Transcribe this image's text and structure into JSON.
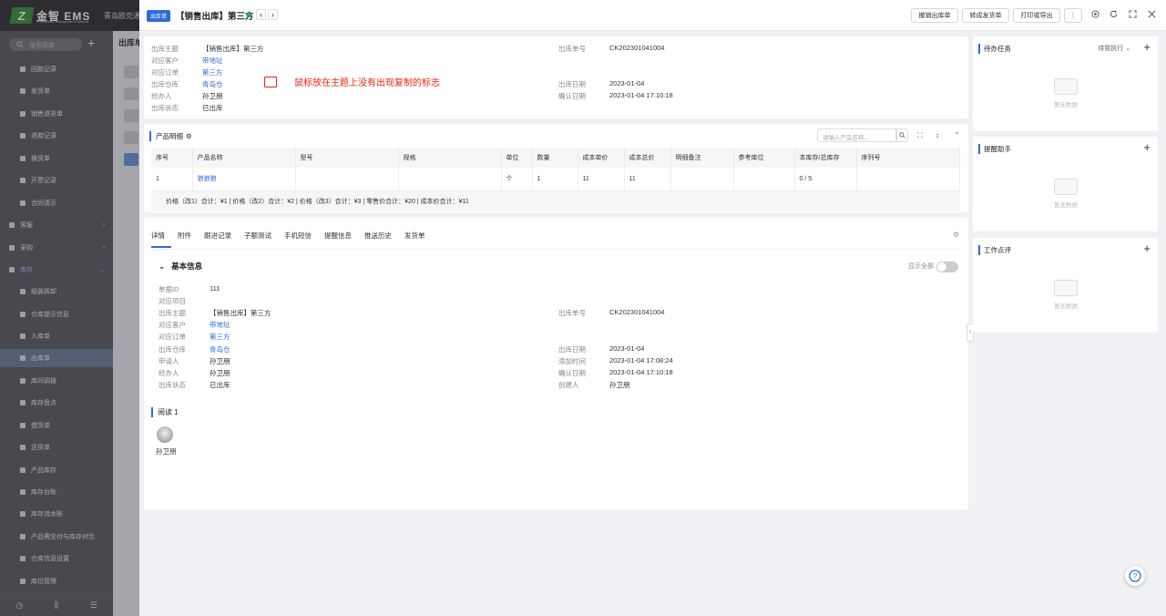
{
  "app": {
    "logo_mark": "Z",
    "logo_name": "金智 EMS",
    "logo_sub": "Enterprise Management System",
    "company": "青岛欧克通信"
  },
  "sidebar": {
    "search_placeholder": "搜索菜单",
    "items": [
      {
        "label": "回款记录"
      },
      {
        "label": "发货单"
      },
      {
        "label": "销售退货单"
      },
      {
        "label": "退款记录"
      },
      {
        "label": "换货单"
      },
      {
        "label": "开票记录"
      },
      {
        "label": "合同请示"
      },
      {
        "label": "客服"
      },
      {
        "label": "采购"
      },
      {
        "label": "库存"
      },
      {
        "label": "组装拆卸"
      },
      {
        "label": "仓库提示信息"
      },
      {
        "label": "入库单"
      },
      {
        "label": "出库单"
      },
      {
        "label": "库间调拨"
      },
      {
        "label": "库存盘点"
      },
      {
        "label": "借货单"
      },
      {
        "label": "还货单"
      },
      {
        "label": "产品库存"
      },
      {
        "label": "库存台账"
      },
      {
        "label": "库存流水账"
      },
      {
        "label": "产品需交付与库存对比"
      },
      {
        "label": "仓库信息设置"
      },
      {
        "label": "库位管理"
      }
    ]
  },
  "background": {
    "main_title": "出库单"
  },
  "drawer": {
    "tag": "出库单",
    "title": "【销售出库】第三方",
    "buttons": {
      "revoke": "撤销出库单",
      "to_delivery": "转成发货单",
      "print": "打印或导出"
    }
  },
  "summary": {
    "fields": {
      "subject_label": "出库主题",
      "subject": "【销售出库】第三方",
      "customer_label": "对应客户",
      "customer": "带地址",
      "order_label": "对应订单",
      "order": "第三方",
      "warehouse_label": "出库仓库",
      "warehouse": "青岛仓",
      "handler_label": "经办人",
      "handler": "孙卫朋",
      "status_label": "出库状态",
      "status": "已出库",
      "no_label": "出库单号",
      "no": "CK202301041004",
      "date_label": "出库日期",
      "date": "2023-01-04",
      "confirm_label": "确认日期",
      "confirm": "2023-01-04 17:10:18"
    },
    "annotation": "鼠标放在主题上没有出现复制的标志"
  },
  "products": {
    "title": "产品明细",
    "search_placeholder": "请输入产品名称...",
    "columns": [
      "序号",
      "产品名称",
      "型号",
      "规格",
      "单位",
      "数量",
      "成本单价",
      "成本总价",
      "明细备注",
      "参考库位",
      "本库存/总库存",
      "序列号"
    ],
    "rows": [
      [
        "1",
        "狼狼狼",
        "",
        "",
        "个",
        "1",
        "11",
        "11",
        "",
        "",
        "0 / 5",
        ""
      ]
    ],
    "summary": "价格（改1）合计：¥1 | 价格（改2）合计：¥2 | 价格（改3）合计：¥3 | 零售价合计：¥20 | 成本价合计：¥11"
  },
  "details": {
    "tabs": [
      "详情",
      "附件",
      "跟进记录",
      "子额测试",
      "手机短信",
      "提醒信息",
      "推送历史",
      "发货单"
    ],
    "section_title": "基本信息",
    "show_all": "显示全部",
    "fields": {
      "id_label": "单据ID",
      "id": "111",
      "project_label": "对应项目",
      "subject_label": "出库主题",
      "subject": "【销售出库】第三方",
      "customer_label": "对应客户",
      "customer": "带地址",
      "order_label": "对应订单",
      "order": "第三方",
      "warehouse_label": "出库仓库",
      "warehouse": "青岛仓",
      "applicant_label": "申请人",
      "applicant": "孙卫朋",
      "handler_label": "经办人",
      "handler": "孙卫朋",
      "status_label": "出库状态",
      "status": "已出库",
      "no_label": "出库单号",
      "no": "CK202301041004",
      "date_label": "出库日期",
      "date": "2023-01-04",
      "added_label": "添加时间",
      "added": "2023-01-04 17:08:24",
      "confirm_label": "确认日期",
      "confirm": "2023-01-04 17:10:18",
      "creator_label": "创建人",
      "creator": "孙卫朋"
    },
    "reads_title": "阅读 1",
    "reader_name": "孙卫朋"
  },
  "panels": {
    "todo": {
      "title": "待办任务",
      "filter": "待我执行",
      "empty": "暂无数据"
    },
    "reminder": {
      "title": "提醒助手",
      "empty": "暂无数据"
    },
    "review": {
      "title": "工作点评",
      "empty": "暂无数据"
    }
  }
}
